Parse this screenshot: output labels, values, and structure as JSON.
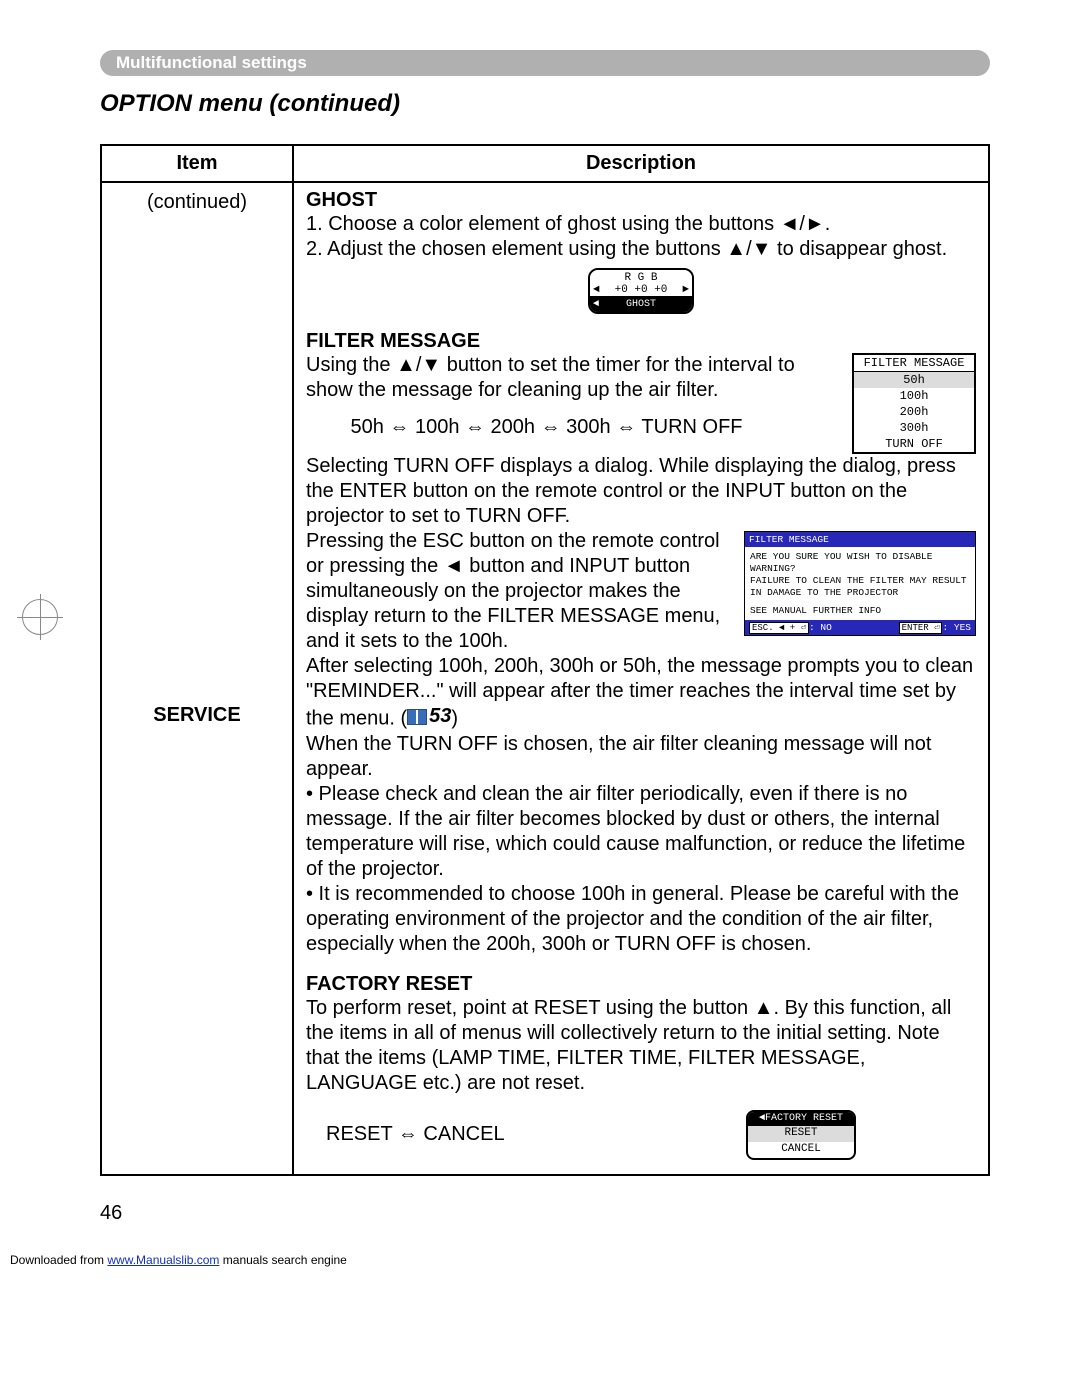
{
  "header": {
    "pill": "Multifunctional settings"
  },
  "title": "OPTION menu (continued)",
  "table": {
    "headers": {
      "item": "Item",
      "desc": "Description"
    },
    "item_continued": "(continued)",
    "item_service": "SERVICE"
  },
  "ghost": {
    "heading": "GHOST",
    "line1_a": "1. Choose a color element of ghost using the buttons ",
    "line1_b": "◄/►.",
    "line2_a": "2. Adjust the chosen element using the buttons ",
    "line2_b": "▲/▼",
    "line2_c": " to disappear ghost.",
    "osd": {
      "rgb": "R   G   B",
      "vals_left_arrow": "◄",
      "vals": "+0   +0   +0",
      "vals_right_arrow": "►",
      "label": "GHOST",
      "bot_left": "◄"
    }
  },
  "filter": {
    "heading": "FILTER MESSAGE",
    "p1a": "Using the ",
    "p1b": "▲/▼",
    "p1c": " button to set the timer for the interval to show the message for cleaning up the air filter.",
    "chain_prefix": "        50h ",
    "chain": "⇔ 100h ⇔ 200h ⇔ 300h ⇔ TURN OFF",
    "list": {
      "title": "FILTER MESSAGE",
      "opts": [
        "50h",
        "100h",
        "200h",
        "300h",
        "TURN OFF"
      ]
    },
    "p2": "Selecting TURN OFF displays a dialog. While displaying the dialog, press the ENTER button on the remote control or the INPUT button on the projector to set to TURN OFF.",
    "p3a": "Pressing the ESC button on the remote control or pressing the ",
    "p3b": "◄",
    "p3c": " button and INPUT button simultaneously on the projector makes the display return to the FILTER MESSAGE menu, and it sets to the 100h.",
    "warn": {
      "title": "FILTER MESSAGE",
      "l1": "ARE YOU SURE YOU WISH TO DISABLE WARNING?",
      "l2": "FAILURE TO CLEAN THE FILTER MAY RESULT IN DAMAGE TO THE PROJECTOR",
      "l3": "SEE MANUAL FURTHER INFO",
      "no_lbl": "ESC. ◄ + ⏎",
      "no_txt": ": NO",
      "yes_lbl": "ENTER ⏎",
      "yes_txt": ": YES"
    },
    "p4a": "After selecting 100h, 200h, 300h or 50h, the message prompts you to clean \"REMINDER...\" will appear after the timer reaches the interval time set by the menu. (",
    "p4ref": "53",
    "p4b": ")",
    "p5": "When the TURN OFF is chosen, the air filter cleaning message will not appear.",
    "p6": "• Please check and clean the air filter periodically, even if there is no message. If the air filter becomes blocked by dust or others, the internal temperature will rise, which could cause malfunction, or reduce the lifetime of the projector.",
    "p7": "• It is recommended to choose 100h in general. Please be careful with the operating environment of the projector and the condition of the air filter, especially when the 200h, 300h or TURN OFF is chosen."
  },
  "factory": {
    "heading": "FACTORY RESET",
    "p1a": "To perform reset, point at RESET using the button ",
    "p1b": "▲",
    "p1c": ". By this function, all the items in all of menus will collectively return to the initial setting. Note that the items (LAMP TIME, FILTER TIME, FILTER MESSAGE, LANGUAGE etc.) are not reset.",
    "chain": "RESET ⇔ CANCEL",
    "osd": {
      "title": "◄FACTORY RESET",
      "r1": "RESET",
      "r2": "CANCEL"
    }
  },
  "page_number": "46",
  "footer": {
    "pre": "Downloaded from ",
    "link": "www.Manualslib.com",
    "post": " manuals search engine"
  }
}
